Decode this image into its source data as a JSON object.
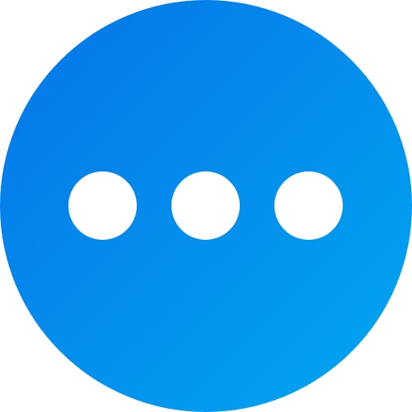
{
  "icon": {
    "name": "more-options-icon",
    "gradient_start": "#0474e8",
    "gradient_end": "#03a7f2",
    "dot_color": "#ffffff",
    "dot_count": 3
  }
}
